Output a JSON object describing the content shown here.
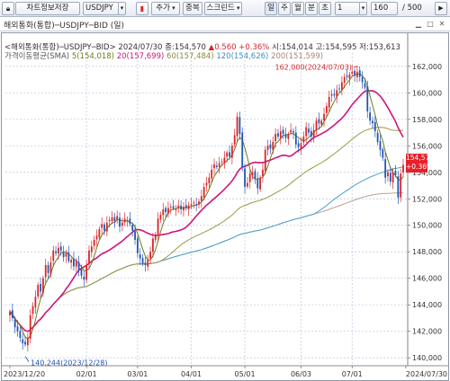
{
  "toolbar": {
    "chart_setting_label": "차트정보저장",
    "symbol_value": "USDJPY",
    "add_label": "추가",
    "overlay_label": "중복",
    "scale_label": "스크린드",
    "period_day": "일",
    "period_week": "주",
    "period_month": "월",
    "period_minute": "분",
    "period_tick": "초",
    "multiplier_value": "1",
    "count_value": "160",
    "total_value": "/ 500"
  },
  "window": {
    "title": "해외통화(통합)─USDJPY─BID (일)"
  },
  "legend": {
    "price_line": "<해외통화(통합)─USDJPY─BID> 2024/07/30 종:154,570",
    "change": "▲0.560 +0.36%",
    "ohlc": "시:154,014 고:154,595 저:153,613",
    "ma_title": "가격이동평균(SMA)",
    "ma5": "5(154,018)",
    "ma20": "20(157,699)",
    "ma60": "60(157,484)",
    "ma120": "120(154,626)",
    "ma200": "200(151,599)"
  },
  "price_tag": {
    "price": "154,570",
    "change": "+0.36%"
  },
  "colors": {
    "up_candle": "#d8262a",
    "down_candle": "#1f56b4",
    "ma5": "#6d7b1c",
    "ma20": "#d0147c",
    "ma60": "#9a9a42",
    "ma120": "#4aa0cf",
    "ma200": "#b9a392"
  },
  "chart_data": {
    "type": "candlestick",
    "symbol": "USDJPY",
    "interval": "daily",
    "ylim": [
      139.4,
      162.6
    ],
    "y_ticks": [
      140,
      142,
      144,
      146,
      148,
      150,
      152,
      154,
      156,
      158,
      160,
      162
    ],
    "y_tick_labels": [
      "140,000",
      "142,000",
      "144,000",
      "146,000",
      "148,000",
      "150,000",
      "152,000",
      "154,000",
      "156,000",
      "158,000",
      "160,000",
      "162,000"
    ],
    "x_ticks": [
      {
        "label": "2023/12/20",
        "index": 0
      },
      {
        "label": "02/01",
        "index": 30
      },
      {
        "label": "03/01",
        "index": 50
      },
      {
        "label": "04/01",
        "index": 71
      },
      {
        "label": "05/01",
        "index": 92
      },
      {
        "label": "06/03",
        "index": 114
      },
      {
        "label": "07/01",
        "index": 134
      },
      {
        "label": "2024/07/30",
        "index": 155
      }
    ],
    "annotations": [
      {
        "label": "162,000(2024/07/03)",
        "index": 136,
        "value": 161.95
      },
      {
        "label": "140,244(2023/12/28)",
        "index": 6,
        "value": 140.24
      }
    ],
    "closes": [
      143.5,
      143.0,
      142.3,
      142.0,
      141.5,
      141.1,
      141.0,
      141.5,
      143.2,
      143.9,
      144.6,
      145.5,
      145.0,
      146.0,
      147.0,
      146.4,
      147.2,
      148.1,
      147.9,
      148.3,
      148.1,
      147.6,
      147.9,
      147.3,
      147.4,
      146.9,
      147.3,
      146.6,
      146.2,
      145.9,
      147.0,
      148.1,
      148.4,
      148.9,
      149.2,
      149.7,
      150.1,
      149.6,
      150.2,
      150.4,
      150.6,
      150.3,
      150.7,
      149.9,
      150.2,
      150.5,
      150.4,
      150.1,
      149.6,
      148.9,
      147.9,
      147.5,
      147.1,
      147.0,
      147.4,
      148.0,
      149.0,
      149.2,
      150.5,
      150.8,
      151.2,
      151.0,
      151.3,
      151.4,
      151.3,
      151.2,
      151.5,
      151.2,
      151.4,
      151.3,
      151.5,
      151.6,
      151.7,
      151.5,
      151.8,
      152.2,
      152.9,
      153.2,
      153.6,
      154.2,
      154.6,
      154.4,
      154.7,
      154.8,
      155.1,
      155.5,
      155.2,
      156.0,
      156.8,
      158.2,
      156.9,
      154.4,
      152.9,
      153.2,
      153.9,
      154.0,
      153.5,
      152.8,
      153.6,
      154.2,
      155.7,
      156.0,
      155.8,
      156.3,
      156.9,
      156.7,
      157.1,
      156.9,
      156.6,
      156.9,
      157.2,
      157.0,
      156.1,
      155.9,
      156.2,
      156.7,
      157.4,
      157.0,
      156.7,
      157.2,
      157.9,
      157.7,
      157.9,
      158.4,
      159.0,
      159.7,
      159.9,
      159.8,
      160.2,
      160.3,
      160.8,
      161.2,
      161.2,
      161.4,
      161.6,
      161.3,
      161.6,
      161.2,
      160.8,
      160.4,
      158.6,
      157.9,
      157.7,
      157.1,
      156.3,
      155.7,
      155.1,
      153.6,
      154.0,
      153.3,
      154.0,
      153.8,
      152.1,
      153.9,
      154.57
    ]
  }
}
